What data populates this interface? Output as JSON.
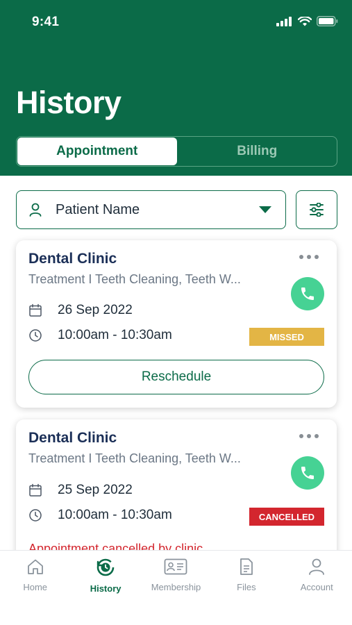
{
  "status_bar": {
    "time": "9:41"
  },
  "header": {
    "title": "History"
  },
  "tabs": [
    {
      "label": "Appointment",
      "active": true
    },
    {
      "label": "Billing",
      "active": false
    }
  ],
  "patient_select": {
    "value": "Patient Name"
  },
  "appointments": [
    {
      "clinic": "Dental Clinic",
      "treatment": "Treatment I Teeth Cleaning, Teeth W...",
      "date": "26 Sep 2022",
      "time": "10:00am - 10:30am",
      "status": "MISSED",
      "action": "Reschedule"
    },
    {
      "clinic": "Dental Clinic",
      "treatment": "Treatment I Teeth Cleaning, Teeth W...",
      "date": "25 Sep 2022",
      "time": "10:00am - 10:30am",
      "status": "CANCELLED",
      "note": "Appointment cancelled by clinic"
    }
  ],
  "bottom_nav": [
    {
      "label": "Home",
      "icon": "home-icon",
      "active": false
    },
    {
      "label": "History",
      "icon": "history-icon",
      "active": true
    },
    {
      "label": "Membership",
      "icon": "membership-card-icon",
      "active": false
    },
    {
      "label": "Files",
      "icon": "file-icon",
      "active": false
    },
    {
      "label": "Account",
      "icon": "user-icon",
      "active": false
    }
  ],
  "colors": {
    "brand": "#0b6b48",
    "call": "#46d294",
    "missed": "#e3b545",
    "cancelled": "#d3262e"
  }
}
